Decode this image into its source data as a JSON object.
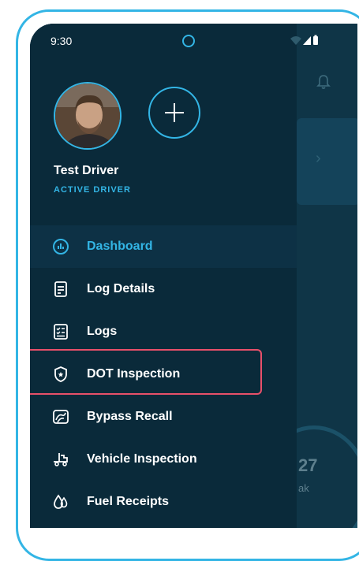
{
  "status_bar": {
    "time": "9:30"
  },
  "profile": {
    "name": "Test Driver",
    "status": "ACTIVE DRIVER"
  },
  "menu": {
    "items": [
      {
        "label": "Dashboard",
        "icon": "dashboard-icon",
        "active": true
      },
      {
        "label": "Log Details",
        "icon": "log-details-icon",
        "active": false
      },
      {
        "label": "Logs",
        "icon": "logs-icon",
        "active": false
      },
      {
        "label": "DOT Inspection",
        "icon": "shield-icon",
        "active": false,
        "highlighted": true
      },
      {
        "label": "Bypass Recall",
        "icon": "bypass-recall-icon",
        "active": false
      },
      {
        "label": "Vehicle Inspection",
        "icon": "truck-icon",
        "active": false
      },
      {
        "label": "Fuel Receipts",
        "icon": "fuel-drop-icon",
        "active": false
      }
    ]
  },
  "background": {
    "gauge_value": "27",
    "gauge_unit": "ak"
  },
  "colors": {
    "accent": "#33b5e5",
    "drawer": "#0a2a3a",
    "highlight": "#e8506a"
  }
}
